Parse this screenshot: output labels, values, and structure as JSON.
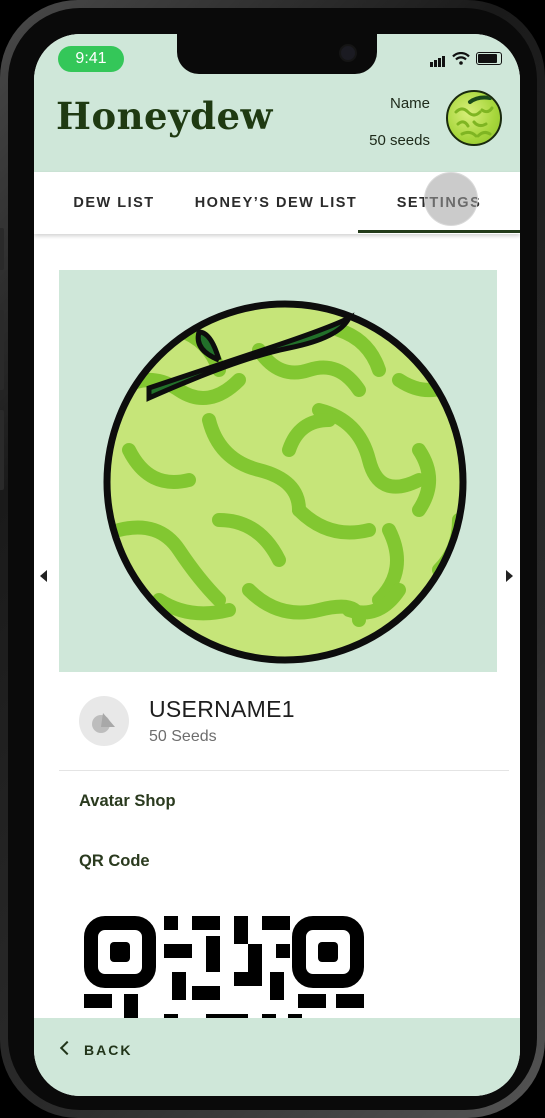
{
  "status": {
    "time": "9:41"
  },
  "header": {
    "title": "Honeydew",
    "user_name": "Name",
    "user_seeds": "50 seeds"
  },
  "tabs": [
    {
      "label": "DEW LIST"
    },
    {
      "label": "HONEY’S DEW LIST"
    },
    {
      "label": "SETTINGS"
    }
  ],
  "profile": {
    "username": "USERNAME1",
    "seeds": "50 Seeds"
  },
  "menu": {
    "avatar_shop": "Avatar Shop",
    "qr_code": "QR Code"
  },
  "footer": {
    "back_label": "BACK"
  },
  "colors": {
    "header_bg": "#cfe7d9",
    "accent": "#233b1a",
    "status_green": "#34c759",
    "melon": "#a6d63b"
  },
  "icons": [
    "wifi-icon",
    "signal-icon",
    "battery-icon",
    "chevron-left-icon",
    "chevron-right-icon",
    "back-chevron-icon",
    "avatar-placeholder-icon"
  ]
}
